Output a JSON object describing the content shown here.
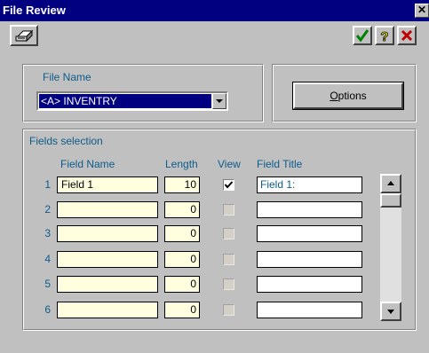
{
  "window": {
    "title": "File Review",
    "close_glyph": "✕"
  },
  "toolbar": {
    "print_icon": "printer-icon",
    "ok_icon": "checkmark-icon",
    "help_icon": "question-mark-icon",
    "cancel_icon": "red-x-icon"
  },
  "file_group": {
    "label": "File Name",
    "selected_file": "<A> INVENTRY"
  },
  "options_button": {
    "label_prefix": "",
    "label_mnemonic": "O",
    "label_rest": "ptions"
  },
  "fields_group": {
    "label": "Fields selection",
    "columns": {
      "field_name": "Field Name",
      "length": "Length",
      "view": "View",
      "field_title": "Field Title"
    },
    "rows": [
      {
        "num": "1",
        "name": "Field 1",
        "length": "10",
        "view": true,
        "title": "Field 1:"
      },
      {
        "num": "2",
        "name": "",
        "length": "0",
        "view": false,
        "title": ""
      },
      {
        "num": "3",
        "name": "",
        "length": "0",
        "view": false,
        "title": ""
      },
      {
        "num": "4",
        "name": "",
        "length": "0",
        "view": false,
        "title": ""
      },
      {
        "num": "5",
        "name": "",
        "length": "0",
        "view": false,
        "title": ""
      },
      {
        "num": "6",
        "name": "",
        "length": "0",
        "view": false,
        "title": ""
      }
    ]
  },
  "colors": {
    "title_bar": "#000080",
    "label_blue": "#0c5c8c",
    "input_bg": "#ffffe0",
    "face": "#c0c0c0"
  }
}
